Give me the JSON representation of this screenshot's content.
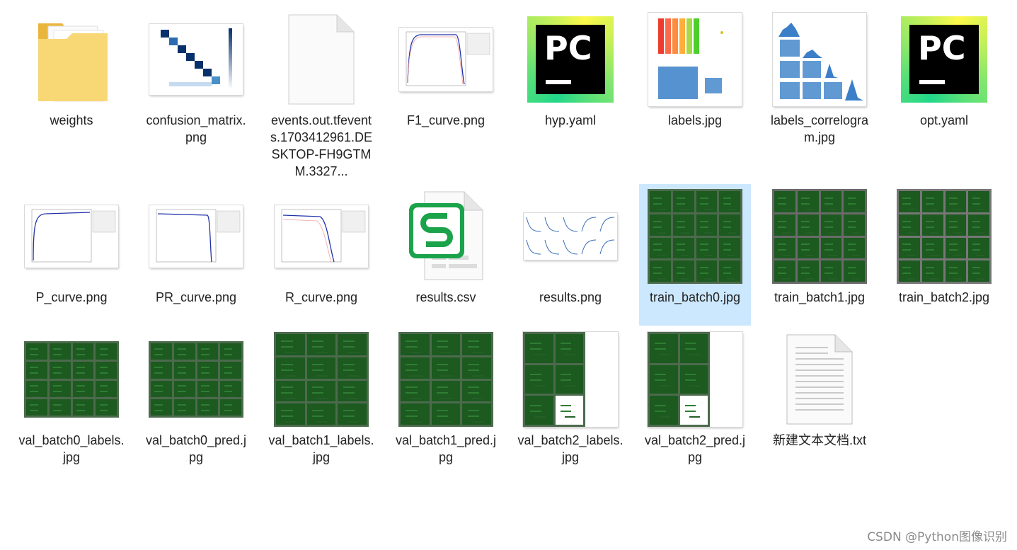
{
  "files": [
    {
      "name": "weights",
      "type": "folder"
    },
    {
      "name": "confusion_matrix.png",
      "type": "chart-image"
    },
    {
      "name": "events.out.tfevents.1703412961.DESKTOP-FH9GTMM.3327...",
      "type": "blank-file"
    },
    {
      "name": "F1_curve.png",
      "type": "chart-image"
    },
    {
      "name": "hyp.yaml",
      "type": "pycharm-file"
    },
    {
      "name": "labels.jpg",
      "type": "chart-image"
    },
    {
      "name": "labels_correlogram.jpg",
      "type": "chart-image"
    },
    {
      "name": "opt.yaml",
      "type": "pycharm-file"
    },
    {
      "name": "P_curve.png",
      "type": "chart-image"
    },
    {
      "name": "PR_curve.png",
      "type": "chart-image"
    },
    {
      "name": "R_curve.png",
      "type": "chart-image"
    },
    {
      "name": "results.csv",
      "type": "csv-file"
    },
    {
      "name": "results.png",
      "type": "chart-image"
    },
    {
      "name": "train_batch0.jpg",
      "type": "mosaic-image",
      "selected": true
    },
    {
      "name": "train_batch1.jpg",
      "type": "mosaic-image"
    },
    {
      "name": "train_batch2.jpg",
      "type": "mosaic-image"
    },
    {
      "name": "val_batch0_labels.jpg",
      "type": "mosaic-image"
    },
    {
      "name": "val_batch0_pred.jpg",
      "type": "mosaic-image"
    },
    {
      "name": "val_batch1_labels.jpg",
      "type": "mosaic-image"
    },
    {
      "name": "val_batch1_pred.jpg",
      "type": "mosaic-image"
    },
    {
      "name": "val_batch2_labels.jpg",
      "type": "mosaic-image"
    },
    {
      "name": "val_batch2_pred.jpg",
      "type": "mosaic-image"
    },
    {
      "name": "新建文本文档.txt",
      "type": "text-file"
    }
  ],
  "watermark": "CSDN @Python图像识别",
  "colors": {
    "selection": "#cce8ff",
    "folder": "#f5c342",
    "csv_green": "#1aa34a"
  }
}
